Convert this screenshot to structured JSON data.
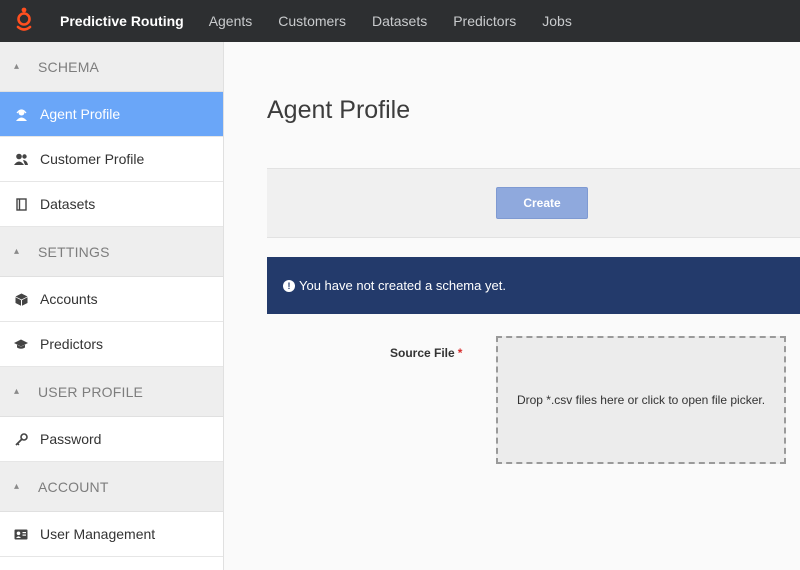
{
  "topbar": {
    "brand": "Predictive Routing",
    "nav": [
      "Agents",
      "Customers",
      "Datasets",
      "Predictors",
      "Jobs"
    ],
    "logo_color": "#ff4f1f"
  },
  "sidebar": {
    "sections": [
      {
        "title": "SCHEMA",
        "items": [
          {
            "label": "Agent Profile",
            "icon": "agent-icon",
            "active": true
          },
          {
            "label": "Customer Profile",
            "icon": "customer-icon"
          },
          {
            "label": "Datasets",
            "icon": "dataset-icon"
          }
        ]
      },
      {
        "title": "SETTINGS",
        "items": [
          {
            "label": "Accounts",
            "icon": "cube-icon"
          },
          {
            "label": "Predictors",
            "icon": "graduation-cap-icon"
          }
        ]
      },
      {
        "title": "USER PROFILE",
        "items": [
          {
            "label": "Password",
            "icon": "key-icon"
          }
        ]
      },
      {
        "title": "ACCOUNT",
        "items": [
          {
            "label": "User Management",
            "icon": "id-card-icon"
          }
        ]
      }
    ],
    "active_color": "#6aa6f8"
  },
  "main": {
    "title": "Agent Profile",
    "create_label": "Create",
    "alert_icon": "info-icon",
    "alert_text": "You have not created a schema yet.",
    "alert_color": "#233a6b",
    "source_file_label": "Source File",
    "required_mark": "*",
    "dropzone_text": "Drop *.csv files here or click to open file picker."
  }
}
